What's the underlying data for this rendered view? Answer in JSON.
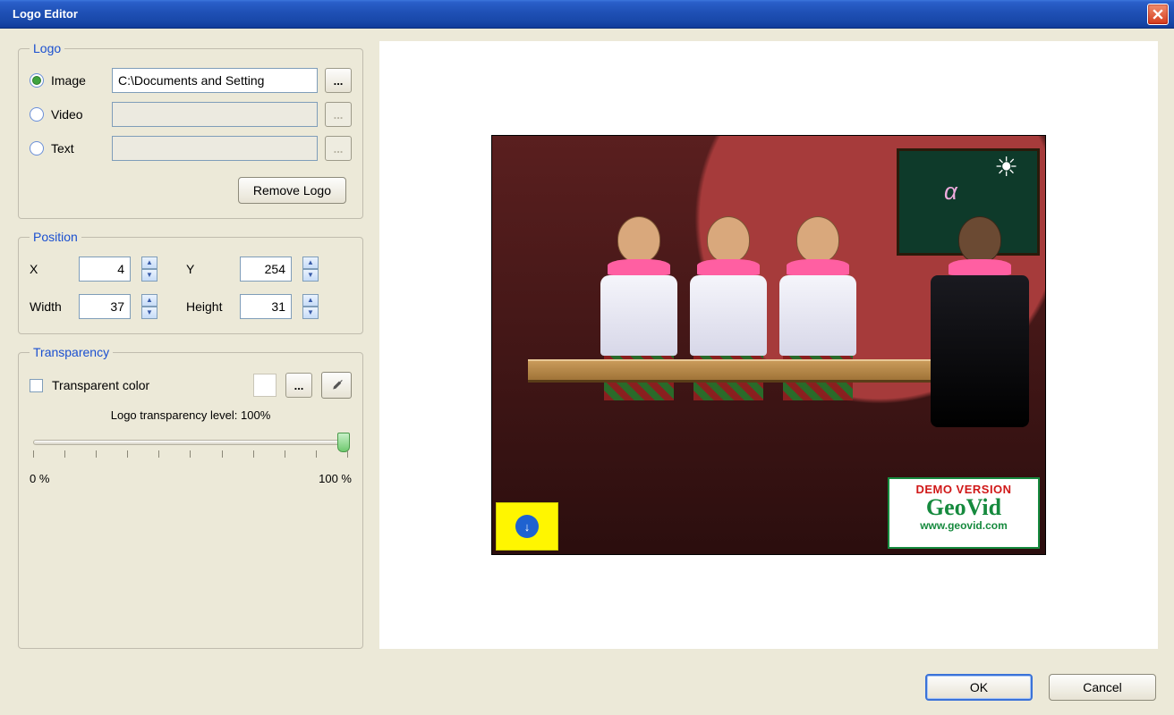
{
  "window": {
    "title": "Logo Editor"
  },
  "logo_group": {
    "legend": "Logo",
    "image_label": "Image",
    "video_label": "Video",
    "text_label": "Text",
    "selected": "image",
    "image_path": "C:\\Documents and Setting",
    "video_path": "",
    "text_value": "",
    "browse_label": "...",
    "remove_button": "Remove Logo"
  },
  "position_group": {
    "legend": "Position",
    "x_label": "X",
    "y_label": "Y",
    "width_label": "Width",
    "height_label": "Height",
    "x": "4",
    "y": "254",
    "width": "37",
    "height": "31"
  },
  "transparency_group": {
    "legend": "Transparency",
    "transparent_color_label": "Transparent color",
    "transparent_color_checked": false,
    "color_browse": "...",
    "level_prefix": "Logo transparency level: ",
    "level_value": "100%",
    "slider_value": 100,
    "min_label": "0 %",
    "max_label": "100 %"
  },
  "preview_overlay": {
    "demo_line1": "DEMO VERSION",
    "demo_line2": "GeoVid",
    "demo_line3": "www.geovid.com"
  },
  "buttons": {
    "ok": "OK",
    "cancel": "Cancel"
  }
}
